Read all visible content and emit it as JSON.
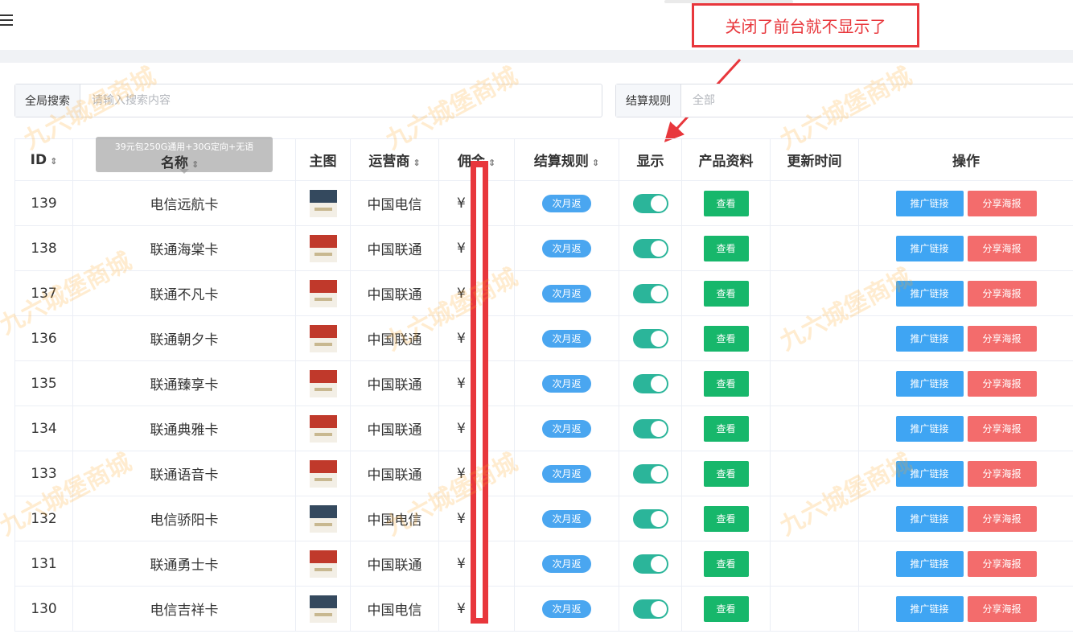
{
  "annotation": {
    "text": "关闭了前台就不显示了"
  },
  "search": {
    "global_label": "全局搜索",
    "global_placeholder": "请输入搜索内容",
    "rule_label": "结算规则",
    "rule_placeholder": "全部"
  },
  "tooltip": {
    "text": "39元包250G通用+30G定向+无语"
  },
  "columns": [
    "ID",
    "名称",
    "主图",
    "运营商",
    "佣金",
    "结算规则",
    "显示",
    "产品资料",
    "更新时间",
    "操作"
  ],
  "rows": [
    {
      "id": "139",
      "name": "电信远航卡",
      "carrier": "中国电信",
      "money": "¥",
      "rule": "次月返",
      "view": "查看",
      "link": "推广链接",
      "share": "分享海报"
    },
    {
      "id": "138",
      "name": "联通海棠卡",
      "carrier": "中国联通",
      "money": "¥",
      "rule": "次月返",
      "view": "查看",
      "link": "推广链接",
      "share": "分享海报"
    },
    {
      "id": "137",
      "name": "联通不凡卡",
      "carrier": "中国联通",
      "money": "¥",
      "rule": "次月返",
      "view": "查看",
      "link": "推广链接",
      "share": "分享海报"
    },
    {
      "id": "136",
      "name": "联通朝夕卡",
      "carrier": "中国联通",
      "money": "¥",
      "rule": "次月返",
      "view": "查看",
      "link": "推广链接",
      "share": "分享海报"
    },
    {
      "id": "135",
      "name": "联通臻享卡",
      "carrier": "中国联通",
      "money": "¥",
      "rule": "次月返",
      "view": "查看",
      "link": "推广链接",
      "share": "分享海报"
    },
    {
      "id": "134",
      "name": "联通典雅卡",
      "carrier": "中国联通",
      "money": "¥",
      "rule": "次月返",
      "view": "查看",
      "link": "推广链接",
      "share": "分享海报"
    },
    {
      "id": "133",
      "name": "联通语音卡",
      "carrier": "中国联通",
      "money": "¥",
      "rule": "次月返",
      "view": "查看",
      "link": "推广链接",
      "share": "分享海报"
    },
    {
      "id": "132",
      "name": "电信骄阳卡",
      "carrier": "中国电信",
      "money": "¥",
      "rule": "次月返",
      "view": "查看",
      "link": "推广链接",
      "share": "分享海报"
    },
    {
      "id": "131",
      "name": "联通勇士卡",
      "carrier": "中国联通",
      "money": "¥",
      "rule": "次月返",
      "view": "查看",
      "link": "推广链接",
      "share": "分享海报"
    },
    {
      "id": "130",
      "name": "电信吉祥卡",
      "carrier": "中国电信",
      "money": "¥",
      "rule": "次月返",
      "view": "查看",
      "link": "推广链接",
      "share": "分享海报"
    }
  ],
  "watermark": "九六城堡商城",
  "colors": {
    "accent_red": "#e8373c",
    "tag_blue": "#4aa6f0",
    "switch_on": "#2bb59a",
    "view_green": "#17b76b",
    "link_blue": "#3fa5f3",
    "share_red": "#f36c6c"
  }
}
